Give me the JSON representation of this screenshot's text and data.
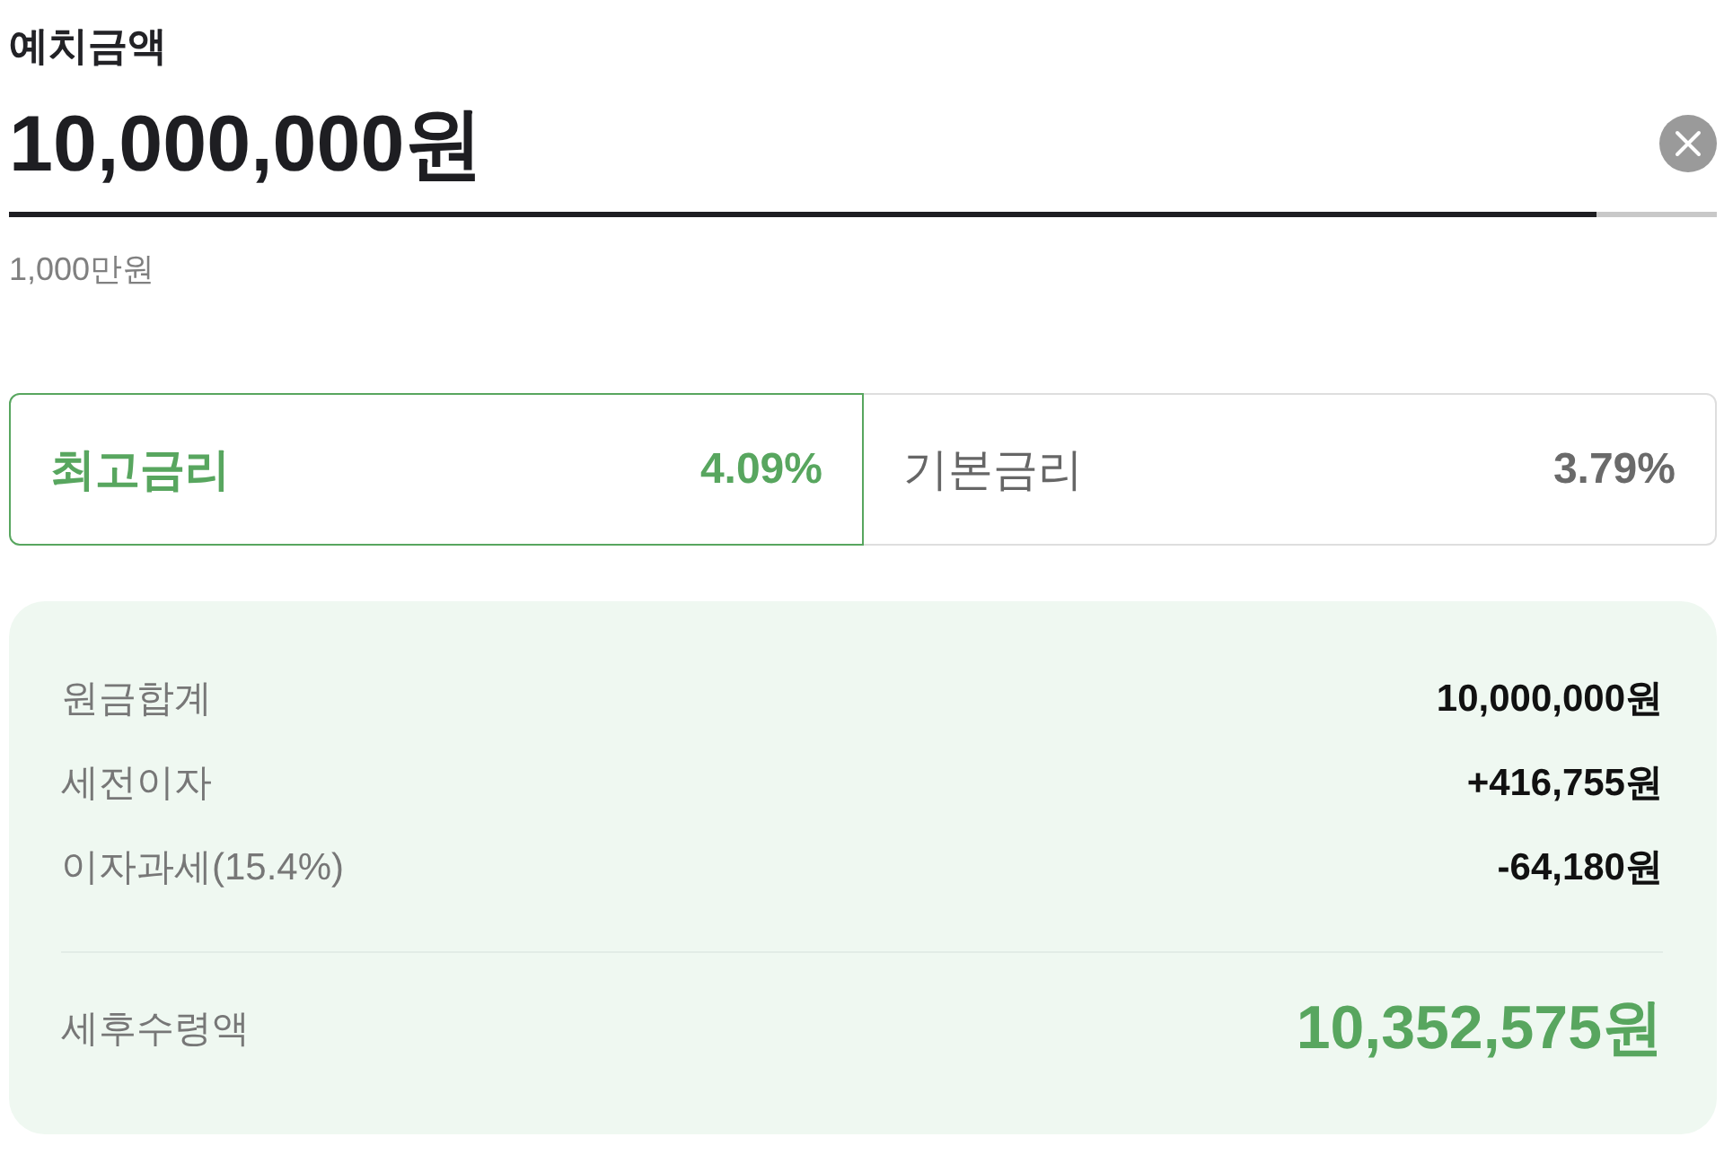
{
  "deposit": {
    "label": "예치금액",
    "value": "10,000,000원",
    "underline": {
      "level": 0.93
    },
    "hint": "1,000만원"
  },
  "rates": [
    {
      "label": "최고금리",
      "rate": "4.09%",
      "selected": true
    },
    {
      "label": "기본금리",
      "rate": "3.79%",
      "selected": false
    }
  ],
  "summary": {
    "rows": [
      {
        "label": "원금합계",
        "value": "10,000,000원"
      },
      {
        "label": "세전이자",
        "value": "+416,755원"
      },
      {
        "label": "이자과세(15.4%)",
        "value": "-64,180원"
      }
    ],
    "total": {
      "label": "세후수령액",
      "value": "10,352,575원"
    }
  }
}
